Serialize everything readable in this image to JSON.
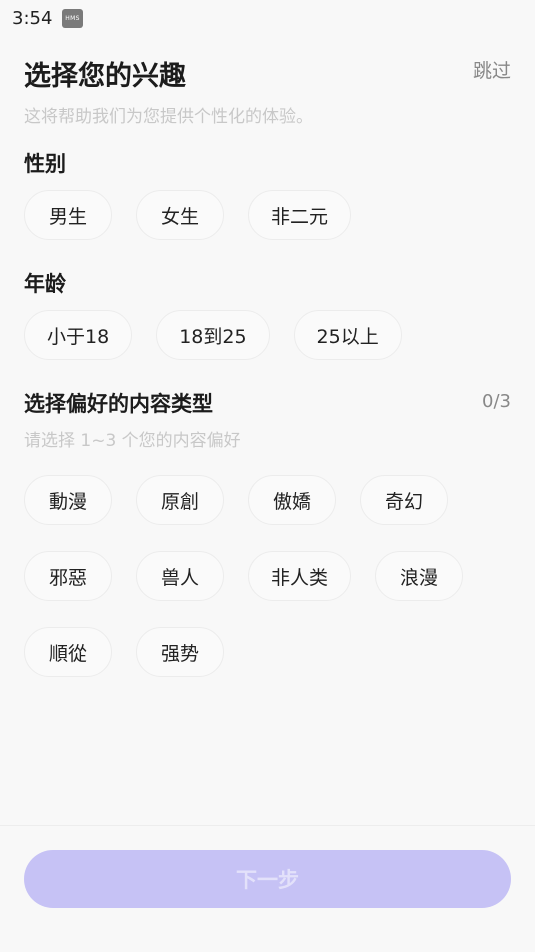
{
  "status_bar": {
    "time": "3:54",
    "app_icon_label": "HMS"
  },
  "header": {
    "title": "选择您的兴趣",
    "skip_label": "跳过",
    "subtitle": "这将帮助我们为您提供个性化的体验。"
  },
  "gender": {
    "title": "性别",
    "options": [
      "男生",
      "女生",
      "非二元"
    ]
  },
  "age": {
    "title": "年龄",
    "options": [
      "小于18",
      "18到25",
      "25以上"
    ]
  },
  "content": {
    "title": "选择偏好的内容类型",
    "counter": "0/3",
    "hint": "请选择 1~3 个您的内容偏好",
    "options": [
      "動漫",
      "原創",
      "傲嬌",
      "奇幻",
      "邪惡",
      "兽人",
      "非人类",
      "浪漫",
      "順從",
      "强势"
    ]
  },
  "footer": {
    "next_label": "下一步"
  },
  "colors": {
    "accent_disabled": "#c6c2f5",
    "background": "#f8f8f8"
  }
}
